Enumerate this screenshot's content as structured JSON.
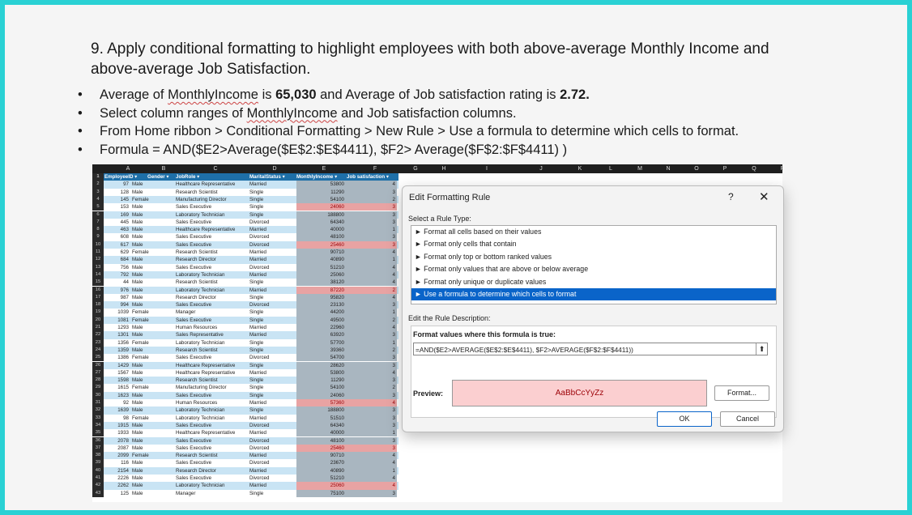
{
  "heading": "9. Apply conditional formatting to highlight employees with both above-average Monthly Income and above-average Job Satisfaction.",
  "bullets": [
    {
      "pre": "Average of ",
      "wavy": "MonthlyIncome",
      "mid": " is ",
      "b1": "65,030",
      "mid2": " and Average of Job satisfaction rating is ",
      "b2": "2.72."
    },
    {
      "pre": "Select column ranges of ",
      "wavy": "MonthlyIncome",
      "mid": " and Job satisfaction columns."
    },
    {
      "pre": "From Home ribbon > Conditional Formatting > New Rule > Use a formula to determine which cells to format."
    },
    {
      "pre": "Formula = AND($E2>Average($E$2:$E$4411), $F2> Average($F$2:$F$4411) )"
    }
  ],
  "sheet": {
    "columns": [
      "A",
      "B",
      "C",
      "D",
      "E",
      "F",
      "G",
      "H",
      "I",
      "J",
      "K",
      "L",
      "M",
      "N",
      "O",
      "P",
      "Q",
      "R"
    ],
    "headers": [
      "EmployeeID",
      "Gender",
      "JobRole",
      "MaritalStatus",
      "MonthlyIncome",
      "Job satisfaction"
    ],
    "rows": [
      [
        "97",
        "Male",
        "Healthcare Representative",
        "Married",
        "53800",
        "4"
      ],
      [
        "128",
        "Male",
        "Research Scientist",
        "Single",
        "11290",
        "3"
      ],
      [
        "145",
        "Female",
        "Manufacturing Director",
        "Single",
        "54100",
        "2"
      ],
      [
        "153",
        "Male",
        "Sales Executive",
        "Single",
        "24060",
        "3"
      ],
      [
        "169",
        "Male",
        "Laboratory Technician",
        "Single",
        "188800",
        "3"
      ],
      [
        "445",
        "Male",
        "Sales Executive",
        "Divorced",
        "64340",
        "3"
      ],
      [
        "463",
        "Male",
        "Healthcare Representative",
        "Married",
        "40000",
        "1"
      ],
      [
        "608",
        "Male",
        "Sales Executive",
        "Divorced",
        "48100",
        "3"
      ],
      [
        "617",
        "Male",
        "Sales Executive",
        "Divorced",
        "25460",
        "3"
      ],
      [
        "629",
        "Female",
        "Research Scientist",
        "Married",
        "90710",
        "4"
      ],
      [
        "684",
        "Male",
        "Research Director",
        "Married",
        "40890",
        "1"
      ],
      [
        "756",
        "Male",
        "Sales Executive",
        "Divorced",
        "51210",
        "4"
      ],
      [
        "792",
        "Male",
        "Laboratory Technician",
        "Married",
        "25060",
        "4"
      ],
      [
        "44",
        "Male",
        "Research Scientist",
        "Single",
        "38120",
        "4"
      ],
      [
        "976",
        "Male",
        "Laboratory Technician",
        "Married",
        "87220",
        "2"
      ],
      [
        "987",
        "Male",
        "Research Director",
        "Single",
        "95820",
        "4"
      ],
      [
        "994",
        "Male",
        "Sales Executive",
        "Divorced",
        "23130",
        "3"
      ],
      [
        "1039",
        "Female",
        "Manager",
        "Single",
        "44200",
        "1"
      ],
      [
        "1081",
        "Female",
        "Sales Executive",
        "Single",
        "49500",
        "2"
      ],
      [
        "1293",
        "Male",
        "Human Resources",
        "Married",
        "22960",
        "4"
      ],
      [
        "1301",
        "Male",
        "Sales Representative",
        "Married",
        "63920",
        "3"
      ],
      [
        "1356",
        "Female",
        "Laboratory Technician",
        "Single",
        "57700",
        "1"
      ],
      [
        "1359",
        "Male",
        "Research Scientist",
        "Single",
        "39360",
        "2"
      ],
      [
        "1386",
        "Female",
        "Sales Executive",
        "Divorced",
        "54700",
        "3"
      ],
      [
        "1429",
        "Male",
        "Healthcare Representative",
        "Single",
        "28620",
        "3"
      ],
      [
        "1567",
        "Male",
        "Healthcare Representative",
        "Married",
        "53800",
        "4"
      ],
      [
        "1598",
        "Male",
        "Research Scientist",
        "Single",
        "11290",
        "3"
      ],
      [
        "1615",
        "Female",
        "Manufacturing Director",
        "Single",
        "54100",
        "2"
      ],
      [
        "1623",
        "Male",
        "Sales Executive",
        "Single",
        "24060",
        "3"
      ],
      [
        "92",
        "Male",
        "Human Resources",
        "Married",
        "57360",
        "4"
      ],
      [
        "1639",
        "Male",
        "Laboratory Technician",
        "Single",
        "188800",
        "3"
      ],
      [
        "98",
        "Female",
        "Laboratory Technician",
        "Married",
        "51510",
        "3"
      ],
      [
        "1915",
        "Male",
        "Sales Executive",
        "Divorced",
        "64340",
        "3"
      ],
      [
        "1933",
        "Male",
        "Healthcare Representative",
        "Married",
        "40000",
        "1"
      ],
      [
        "2078",
        "Male",
        "Sales Executive",
        "Divorced",
        "48100",
        "3"
      ],
      [
        "2087",
        "Male",
        "Sales Executive",
        "Divorced",
        "25460",
        "3"
      ],
      [
        "2099",
        "Female",
        "Research Scientist",
        "Married",
        "90710",
        "4"
      ],
      [
        "116",
        "Male",
        "Sales Executive",
        "Divorced",
        "23670",
        "4"
      ],
      [
        "2154",
        "Male",
        "Research Director",
        "Married",
        "40890",
        "1"
      ],
      [
        "2226",
        "Male",
        "Sales Executive",
        "Divorced",
        "51210",
        "4"
      ],
      [
        "2262",
        "Male",
        "Laboratory Technician",
        "Married",
        "25060",
        "4"
      ],
      [
        "125",
        "Male",
        "Manager",
        "Single",
        "75100",
        "3"
      ]
    ],
    "highlighted_rows": [
      5,
      10,
      16,
      31,
      37,
      42
    ]
  },
  "dialog": {
    "title": "Edit Formatting Rule",
    "help": "?",
    "close": "✕",
    "select_label": "Select a Rule Type:",
    "rule_types": [
      "► Format all cells based on their values",
      "► Format only cells that contain",
      "► Format only top or bottom ranked values",
      "► Format only values that are above or below average",
      "► Format only unique or duplicate values",
      "► Use a formula to determine which cells to format"
    ],
    "selected_rule_index": 5,
    "edit_label": "Edit the Rule Description:",
    "formula_label": "Format values where this formula is true:",
    "formula": "=AND($E2>AVERAGE($E$2:$E$4411), $F2>AVERAGE($F$2:$F$4411))",
    "preview_label": "Preview:",
    "preview_text": "AaBbCcYyZz",
    "format_button": "Format...",
    "ok_button": "OK",
    "cancel_button": "Cancel"
  }
}
